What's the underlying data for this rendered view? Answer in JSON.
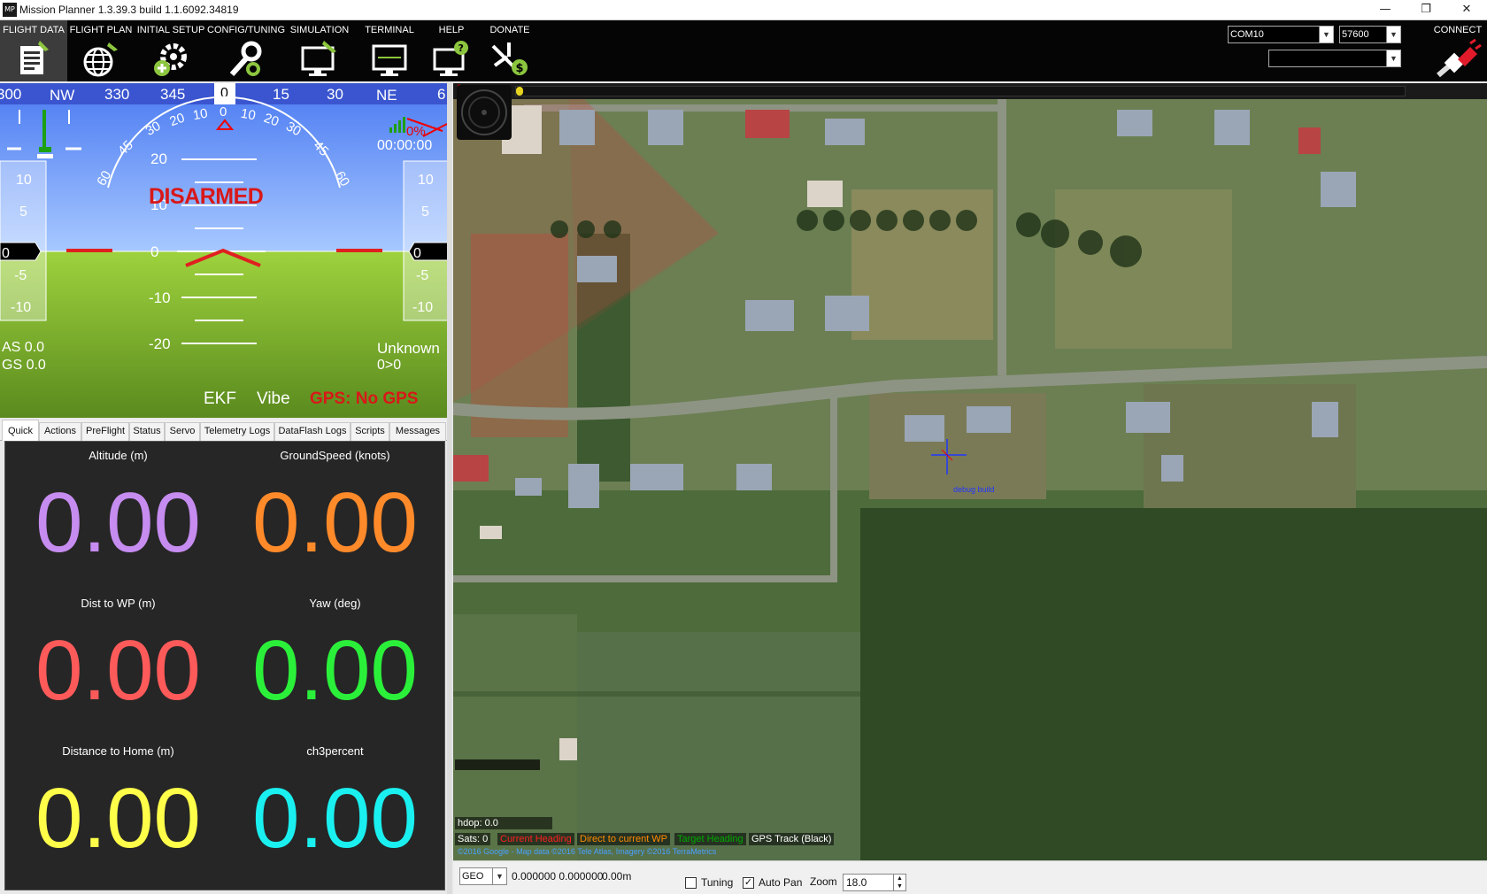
{
  "window": {
    "title": "Mission Planner 1.3.39.3 build 1.1.6092.34819",
    "icon_text": "MP",
    "min": "—",
    "max": "❐",
    "close": "✕"
  },
  "menu": [
    {
      "label": "FLIGHT DATA",
      "icon": "flight-data-icon"
    },
    {
      "label": "FLIGHT PLAN",
      "icon": "globe-icon"
    },
    {
      "label": "INITIAL SETUP",
      "icon": "setup-gear-icon"
    },
    {
      "label": "CONFIG/TUNING",
      "icon": "wrench-icon"
    },
    {
      "label": "SIMULATION",
      "icon": "simulation-monitor-icon"
    },
    {
      "label": "TERMINAL",
      "icon": "terminal-icon"
    },
    {
      "label": "HELP",
      "icon": "help-icon"
    },
    {
      "label": "DONATE",
      "icon": "donate-plane-icon"
    }
  ],
  "connection": {
    "port": "COM10",
    "baud": "57600",
    "extra": "",
    "connect_label": "CONNECT"
  },
  "hud": {
    "heading_ticks": [
      "300",
      "NW",
      "330",
      "345",
      "0",
      "15",
      "30",
      "NE",
      "6"
    ],
    "pitch_ticks": [
      "20",
      "10",
      "0",
      "-10",
      "-20"
    ],
    "roll_ticks": [
      "60",
      "45",
      "30",
      "20",
      "10",
      "0",
      "10",
      "20",
      "30",
      "45",
      "60"
    ],
    "status": "DISARMED",
    "battery": "0%",
    "timer": "00:00:00",
    "alt_ticks": [
      "10",
      "5",
      "0",
      "-5",
      "-10"
    ],
    "spd_ticks": [
      "10",
      "5",
      "0",
      "-5",
      "-10"
    ],
    "speed_box": "0",
    "alt_box": "0",
    "airspeed": "AS 0.0",
    "groundspeed": "GS 0.0",
    "mode": "Unknown",
    "wp": "0>0",
    "ekf": "EKF",
    "vibe": "Vibe",
    "gps": "GPS: No GPS"
  },
  "tabs": [
    "Quick",
    "Actions",
    "PreFlight",
    "Status",
    "Servo",
    "Telemetry Logs",
    "DataFlash Logs",
    "Scripts",
    "Messages"
  ],
  "quick": [
    {
      "label": "Altitude (m)",
      "value": "0.00",
      "color": "#c68cf0"
    },
    {
      "label": "GroundSpeed (knots)",
      "value": "0.00",
      "color": "#ff8a2a"
    },
    {
      "label": "Dist to WP (m)",
      "value": "0.00",
      "color": "#ff5a5a"
    },
    {
      "label": "Yaw (deg)",
      "value": "0.00",
      "color": "#2bf03a"
    },
    {
      "label": "Distance to Home (m)",
      "value": "0.00",
      "color": "#ffff4a"
    },
    {
      "label": "ch3percent",
      "value": "0.00",
      "color": "#1af0f0"
    }
  ],
  "map": {
    "top_indicator": "0",
    "hdop": "hdop: 0.0",
    "sats": "Sats: 0",
    "legend": [
      {
        "label": "Current Heading",
        "color": "#ff2020"
      },
      {
        "label": "Direct to current WP",
        "color": "#ff8c00"
      },
      {
        "label": "Target Heading",
        "color": "#00aa00"
      },
      {
        "label": "GPS Track (Black)",
        "color": "#ffffff"
      }
    ],
    "copyright": "©2016 Google - Map data ©2016 Tele Atlas, Imagery ©2016 TerraMetrics",
    "debug_label": "debug build"
  },
  "bottom": {
    "coord_system": "GEO",
    "coords": "0.000000 0.000000",
    "alt": "0.00m",
    "tuning_label": "Tuning",
    "tuning_checked": false,
    "autopan_label": "Auto Pan",
    "autopan_checked": true,
    "zoom_label": "Zoom",
    "zoom_value": "18.0"
  }
}
